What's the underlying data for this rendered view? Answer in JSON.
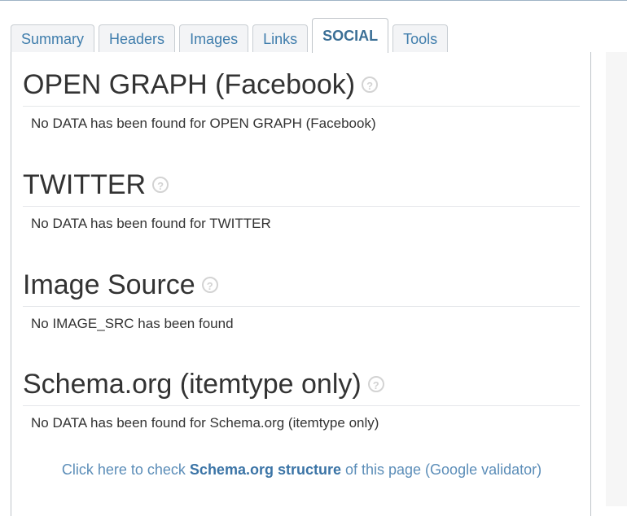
{
  "tabs": [
    {
      "label": "Summary",
      "active": false
    },
    {
      "label": "Headers",
      "active": false
    },
    {
      "label": "Images",
      "active": false
    },
    {
      "label": "Links",
      "active": false
    },
    {
      "label": "SOCIAL",
      "active": true
    },
    {
      "label": "Tools",
      "active": false
    }
  ],
  "sections": [
    {
      "title": "OPEN GRAPH (Facebook)",
      "message": "No DATA has been found for OPEN GRAPH (Facebook)"
    },
    {
      "title": "TWITTER",
      "message": "No DATA has been found for TWITTER"
    },
    {
      "title": "Image Source",
      "message": "No IMAGE_SRC has been found"
    },
    {
      "title": "Schema.org (itemtype only)",
      "message": "No DATA has been found for Schema.org (itemtype only)"
    }
  ],
  "help_glyph": "?",
  "footer": {
    "prefix": "Click here to check ",
    "bold": "Schema.org structure",
    "suffix": " of this page (Google validator)"
  }
}
